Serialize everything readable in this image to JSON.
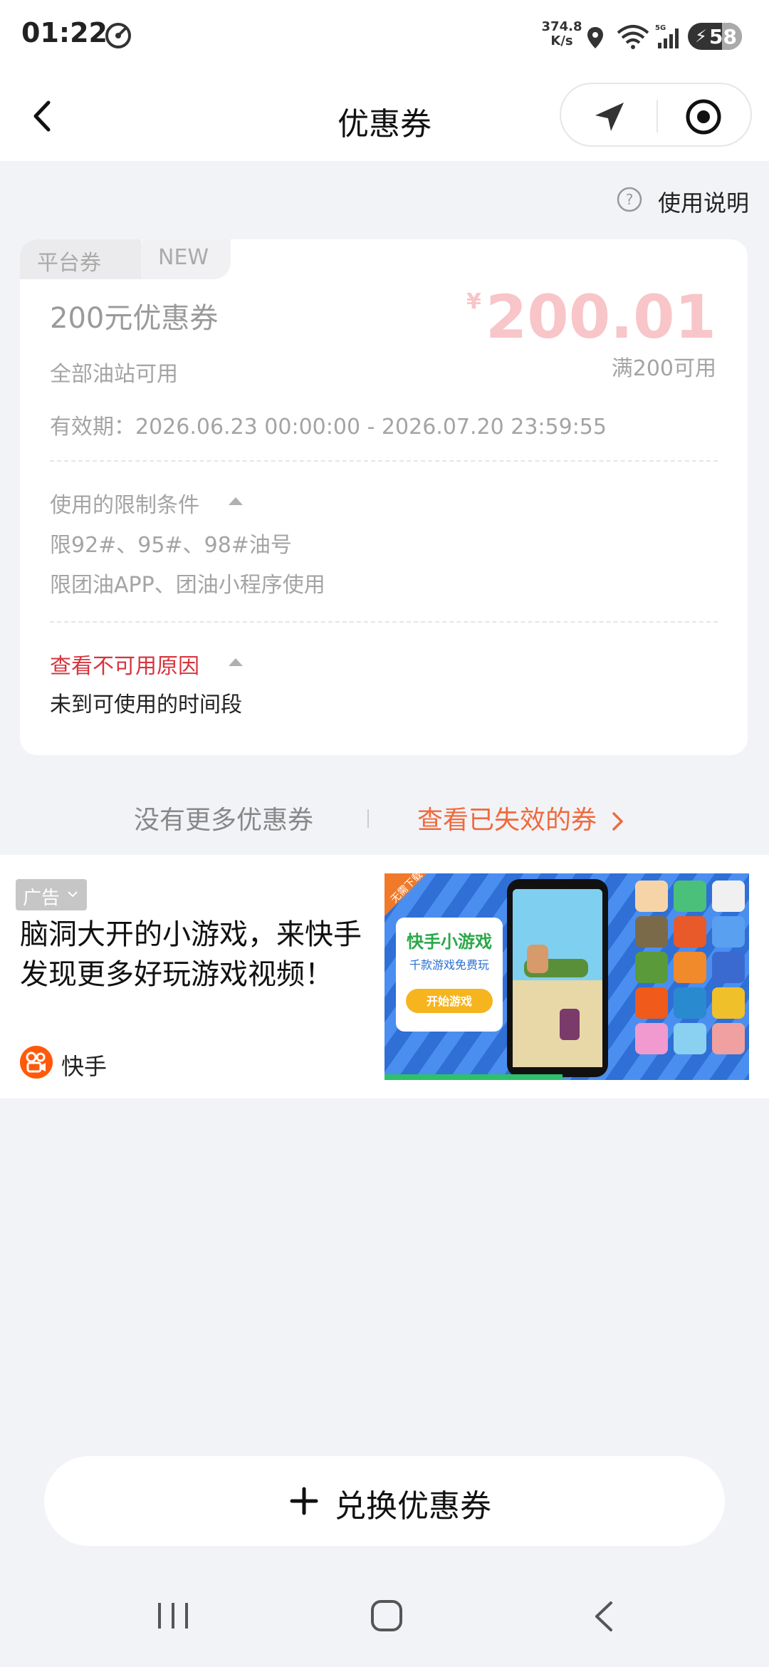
{
  "status_bar": {
    "time": "01:22",
    "net_speed_value": "374.8",
    "net_speed_unit": "K/s",
    "battery": "58"
  },
  "header": {
    "title": "优惠券"
  },
  "usage_help": {
    "label": "使用说明"
  },
  "coupon": {
    "tag_platform": "平台券",
    "tag_new": "NEW",
    "name": "200元优惠券",
    "currency": "¥",
    "amount": "200.01",
    "threshold": "满200可用",
    "scope": "全部油站可用",
    "validity": "有效期：2026.06.23 00:00:00 - 2026.07.20 23:59:55",
    "restrictions_title": "使用的限制条件",
    "restrictions": [
      "限92#、95#、98#油号",
      "限团油APP、团油小程序使用"
    ],
    "unavailable_title": "查看不可用原因",
    "unavailable_reason": "未到可使用的时间段"
  },
  "more": {
    "no_more": "没有更多优惠券",
    "view_expired": "查看已失效的券"
  },
  "ad": {
    "label": "广告",
    "text": "脑洞大开的小游戏，来快手发现更多好玩游戏视频！",
    "brand": "快手",
    "image_title": "快手小游戏",
    "image_sub": "千款游戏免费玩",
    "image_cta": "开始游戏",
    "image_ribbon": "无需下载"
  },
  "redeem": {
    "label": "兑换优惠券"
  },
  "colors": {
    "accent_orange": "#f06a3c",
    "reason_red": "#d6343e",
    "amount_pink": "#f8c5c8",
    "background": "#f2f3f7"
  }
}
